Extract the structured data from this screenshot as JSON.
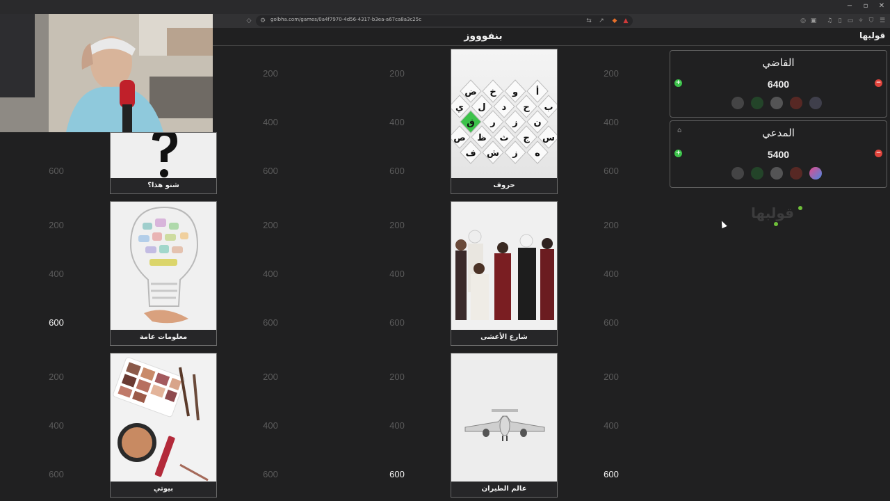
{
  "browser": {
    "url": "golbha.com/games/0a4f7970-4d56-4317-b3ea-a67ca8a3c25c",
    "window_controls": [
      "−",
      "▫",
      "✕"
    ]
  },
  "header": {
    "title": "بنفوووز",
    "brand": "قولبها"
  },
  "board": {
    "categories": [
      {
        "label": "شنو هذا؟",
        "icon": "question-mark"
      },
      {
        "label": "حروف",
        "icon": "letters-grid"
      },
      {
        "label": "معلومات عامة",
        "icon": "lightbulb"
      },
      {
        "label": "شارع الأعشى",
        "icon": "people-photo"
      },
      {
        "label": "بيوتي",
        "icon": "makeup"
      },
      {
        "label": "عالم الطيران",
        "icon": "airplane"
      }
    ],
    "points": [
      "200",
      "400",
      "600"
    ],
    "letters": [
      "ض",
      "خ",
      "و",
      "أ",
      "ي",
      "ل",
      "د",
      "ح",
      "ب",
      "ق",
      "ر",
      "ز",
      "ن",
      "ص",
      "ظ",
      "ث",
      "ج",
      "س",
      "ف",
      "ش",
      "ز",
      "ه"
    ]
  },
  "teams": [
    {
      "name": "القاضي",
      "score": "6400"
    },
    {
      "name": "المدعي",
      "score": "5400"
    }
  ],
  "controls": {
    "plus": "+",
    "minus": "−"
  },
  "colors": {
    "active_green": "#3cc24a",
    "remove_red": "#e0443c",
    "background": "#202021"
  }
}
